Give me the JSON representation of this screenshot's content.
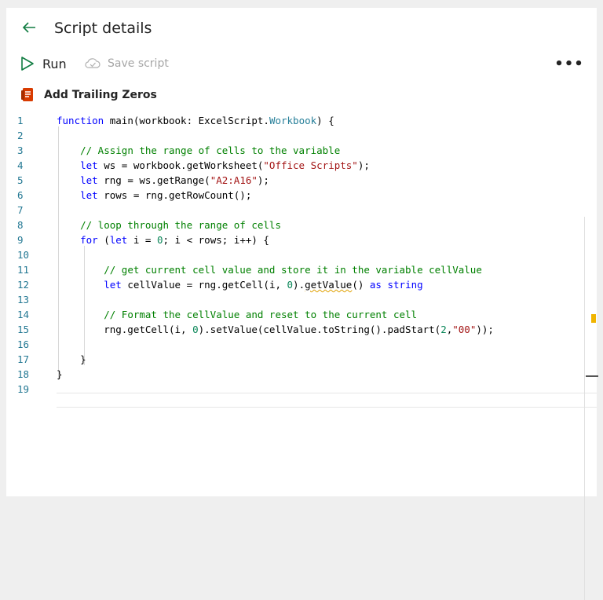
{
  "header": {
    "title": "Script details",
    "back_icon": "arrow-left-icon"
  },
  "toolbar": {
    "run_label": "Run",
    "save_label": "Save script",
    "more_label": "•••"
  },
  "script": {
    "name": "Add Trailing Zeros",
    "icon_color": "#d83b01"
  },
  "editor": {
    "line_numbers": [
      "1",
      "2",
      "3",
      "4",
      "5",
      "6",
      "7",
      "8",
      "9",
      "10",
      "11",
      "12",
      "13",
      "14",
      "15",
      "16",
      "17",
      "18",
      "19"
    ],
    "lines": [
      "function main(workbook: ExcelScript.Workbook) {",
      "",
      "    // Assign the range of cells to the variable",
      "    let ws = workbook.getWorksheet(\"Office Scripts\");",
      "    let rng = ws.getRange(\"A2:A16\");",
      "    let rows = rng.getRowCount();",
      "",
      "    // loop through the range of cells",
      "    for (let i = 0; i < rows; i++) {",
      "",
      "        // get current cell value and store it in the variable cellValue",
      "        let cellValue = rng.getCell(i, 0).getValue() as string",
      "",
      "        // Format the cellValue and reset to the current cell",
      "        rng.getCell(i, 0).setValue(cellValue.toString().padStart(2,\"00\"));",
      "",
      "    }",
      "}",
      ""
    ]
  }
}
